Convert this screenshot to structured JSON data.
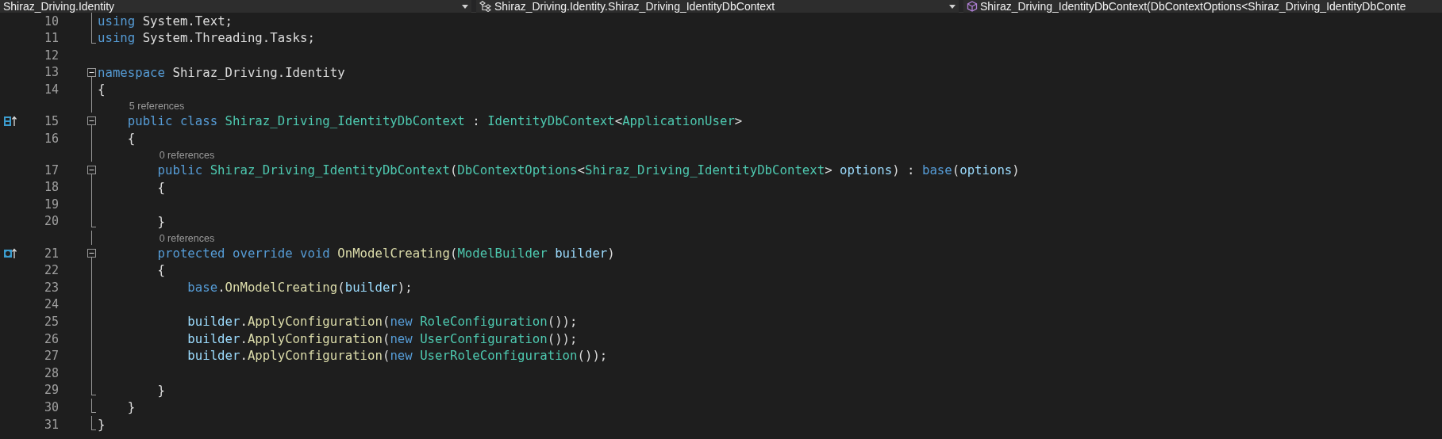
{
  "navigation_bar": [
    {
      "text": "Shiraz_Driving.Identity",
      "caret": true
    },
    {
      "text": "Shiraz_Driving.Identity.Shiraz_Driving_IdentityDbContext",
      "caret": true
    },
    {
      "text": "Shiraz_Driving_IdentityDbContext(DbContextOptions<Shiraz_Driving_IdentityDbConte",
      "caret": false
    }
  ],
  "editor": {
    "lines": [
      {
        "number": "10",
        "collapsible": false,
        "fold_end": false,
        "tokens": [
          {
            "kind": "keyword",
            "text": "using"
          },
          {
            "kind": "plain",
            "text": " System.Text;"
          }
        ]
      },
      {
        "number": "11",
        "collapsible": false,
        "fold_end": true,
        "tokens": [
          {
            "kind": "keyword",
            "text": "using"
          },
          {
            "kind": "plain",
            "text": " System.Threading.Tasks;"
          }
        ]
      },
      {
        "number": "12",
        "collapsible": false,
        "fold_end": false
      },
      {
        "number": "13",
        "collapsible": true,
        "fold_end": false,
        "tokens": [
          {
            "kind": "keyword",
            "text": "namespace"
          },
          {
            "kind": "plain",
            "text": " Shiraz_Driving.Identity"
          }
        ]
      },
      {
        "number": "14",
        "collapsible": false,
        "fold_end": false,
        "tokens": [
          {
            "kind": "plain",
            "text": "{"
          }
        ]
      },
      {
        "number": "15",
        "gutter_marker": {
          "kind": "type"
        },
        "collapsible": true,
        "fold_end": false,
        "codelens": "5 references",
        "tokens": [
          {
            "kind": "keyword",
            "text": "    public "
          },
          {
            "kind": "keyword",
            "text": "class "
          },
          {
            "kind": "type",
            "text": "Shiraz_Driving_IdentityDbContext"
          },
          {
            "kind": "plain",
            "text": " : "
          },
          {
            "kind": "type",
            "text": "IdentityDbContext"
          },
          {
            "kind": "plain",
            "text": "<"
          },
          {
            "kind": "type",
            "text": "ApplicationUser"
          },
          {
            "kind": "plain",
            "text": ">"
          }
        ]
      },
      {
        "number": "16",
        "collapsible": false,
        "fold_end": false,
        "tokens": [
          {
            "kind": "plain",
            "text": "    {"
          }
        ]
      },
      {
        "number": "17",
        "collapsible": true,
        "fold_end": false,
        "codelens": "0 references",
        "tokens": [
          {
            "kind": "keyword",
            "text": "        public "
          },
          {
            "kind": "type",
            "text": "Shiraz_Driving_IdentityDbContext"
          },
          {
            "kind": "plain",
            "text": "("
          },
          {
            "kind": "type",
            "text": "DbContextOptions"
          },
          {
            "kind": "plain",
            "text": "<"
          },
          {
            "kind": "type",
            "text": "Shiraz_Driving_IdentityDbContext"
          },
          {
            "kind": "plain",
            "text": "> "
          },
          {
            "kind": "param",
            "text": "options"
          },
          {
            "kind": "plain",
            "text": ") : "
          },
          {
            "kind": "keyword",
            "text": "base"
          },
          {
            "kind": "plain",
            "text": "("
          },
          {
            "kind": "param",
            "text": "options"
          },
          {
            "kind": "plain",
            "text": ")"
          }
        ]
      },
      {
        "number": "18",
        "collapsible": false,
        "fold_end": false,
        "tokens": [
          {
            "kind": "plain",
            "text": "        {"
          }
        ]
      },
      {
        "number": "19",
        "collapsible": false,
        "fold_end": false
      },
      {
        "number": "20",
        "collapsible": false,
        "fold_end": true,
        "tokens": [
          {
            "kind": "plain",
            "text": "        }"
          }
        ]
      },
      {
        "number": "21",
        "gutter_marker": {
          "kind": "member"
        },
        "collapsible": true,
        "fold_end": false,
        "codelens": "0 references",
        "tokens": [
          {
            "kind": "keyword",
            "text": "        protected "
          },
          {
            "kind": "keyword",
            "text": "override "
          },
          {
            "kind": "keyword",
            "text": "void "
          },
          {
            "kind": "method",
            "text": "OnModelCreating"
          },
          {
            "kind": "plain",
            "text": "("
          },
          {
            "kind": "type",
            "text": "ModelBuilder"
          },
          {
            "kind": "param",
            "text": " builder"
          },
          {
            "kind": "plain",
            "text": ")"
          }
        ]
      },
      {
        "number": "22",
        "collapsible": false,
        "fold_end": false,
        "tokens": [
          {
            "kind": "plain",
            "text": "        {"
          }
        ]
      },
      {
        "number": "23",
        "collapsible": false,
        "fold_end": false,
        "tokens": [
          {
            "kind": "keyword",
            "text": "            base"
          },
          {
            "kind": "plain",
            "text": "."
          },
          {
            "kind": "method",
            "text": "OnModelCreating"
          },
          {
            "kind": "plain",
            "text": "("
          },
          {
            "kind": "param",
            "text": "builder"
          },
          {
            "kind": "plain",
            "text": ");"
          }
        ]
      },
      {
        "number": "24",
        "collapsible": false,
        "fold_end": false
      },
      {
        "number": "25",
        "collapsible": false,
        "fold_end": false,
        "tokens": [
          {
            "kind": "param",
            "text": "            builder"
          },
          {
            "kind": "plain",
            "text": "."
          },
          {
            "kind": "method",
            "text": "ApplyConfiguration"
          },
          {
            "kind": "plain",
            "text": "("
          },
          {
            "kind": "keyword",
            "text": "new "
          },
          {
            "kind": "type",
            "text": "RoleConfiguration"
          },
          {
            "kind": "plain",
            "text": "());"
          }
        ]
      },
      {
        "number": "26",
        "collapsible": false,
        "fold_end": false,
        "tokens": [
          {
            "kind": "param",
            "text": "            builder"
          },
          {
            "kind": "plain",
            "text": "."
          },
          {
            "kind": "method",
            "text": "ApplyConfiguration"
          },
          {
            "kind": "plain",
            "text": "("
          },
          {
            "kind": "keyword",
            "text": "new "
          },
          {
            "kind": "type",
            "text": "UserConfiguration"
          },
          {
            "kind": "plain",
            "text": "());"
          }
        ]
      },
      {
        "number": "27",
        "collapsible": false,
        "fold_end": false,
        "tokens": [
          {
            "kind": "param",
            "text": "            builder"
          },
          {
            "kind": "plain",
            "text": "."
          },
          {
            "kind": "method",
            "text": "ApplyConfiguration"
          },
          {
            "kind": "plain",
            "text": "("
          },
          {
            "kind": "keyword",
            "text": "new "
          },
          {
            "kind": "type",
            "text": "UserRoleConfiguration"
          },
          {
            "kind": "plain",
            "text": "());"
          }
        ]
      },
      {
        "number": "28",
        "collapsible": false,
        "fold_end": false
      },
      {
        "number": "29",
        "collapsible": false,
        "fold_end": true,
        "tokens": [
          {
            "kind": "plain",
            "text": "        }"
          }
        ]
      },
      {
        "number": "30",
        "collapsible": false,
        "fold_end": true,
        "tokens": [
          {
            "kind": "plain",
            "text": "    }"
          }
        ]
      },
      {
        "number": "31",
        "collapsible": false,
        "fold_end": true,
        "tokens": [
          {
            "kind": "plain",
            "text": "}"
          }
        ]
      }
    ]
  }
}
